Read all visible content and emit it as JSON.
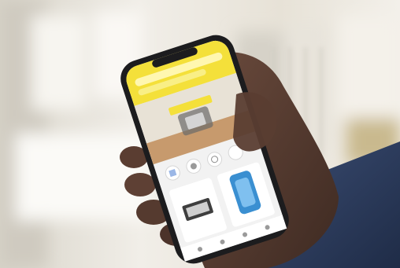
{
  "photo": {
    "description_colors": {
      "background_wall": "#e9e4da",
      "window_light": "#f6f3ec",
      "hand_skin": "#5b3f33",
      "sleeve": "#2b3c5e",
      "phone_frame": "#1c1c1e",
      "app_accent": "#f4e03a",
      "app_banner": "#c79a6d",
      "app_bg": "#f2f2f2"
    },
    "icons": [
      "smartphone-icon"
    ]
  }
}
